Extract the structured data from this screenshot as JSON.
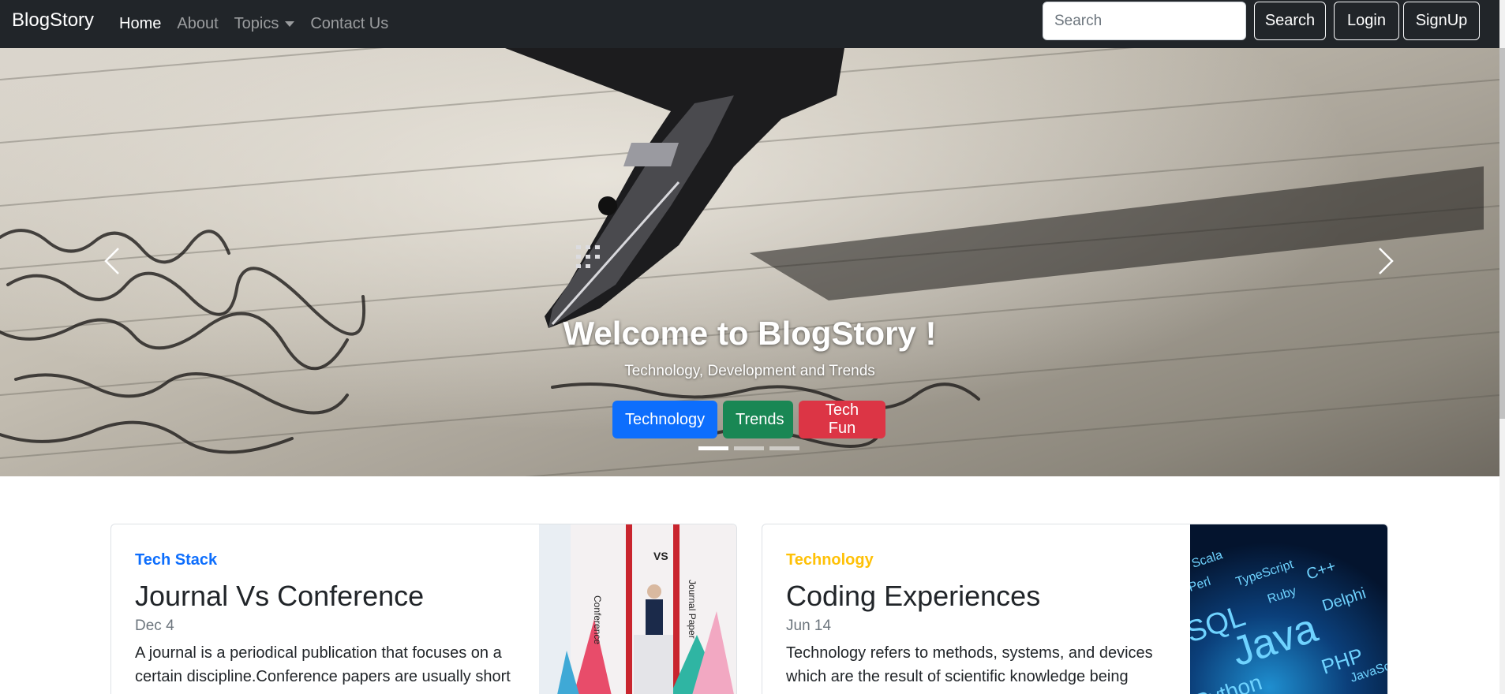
{
  "navbar": {
    "brand": "BlogStory",
    "links": [
      {
        "label": "Home",
        "active": true
      },
      {
        "label": "About"
      },
      {
        "label": "Topics",
        "dropdown": true
      },
      {
        "label": "Contact Us"
      }
    ],
    "search_placeholder": "Search",
    "search_button": "Search",
    "login_button": "Login",
    "signup_button": "SignUp"
  },
  "hero": {
    "title": "Welcome to BlogStory !",
    "subtitle": "Technology, Development and Trends",
    "buttons": [
      {
        "label": "Technology",
        "color": "#0d6efd"
      },
      {
        "label": "Trends",
        "color": "#198754"
      },
      {
        "label": "Tech Fun",
        "color": "#dc3545"
      }
    ],
    "active_slide": 1,
    "slide_count": 3
  },
  "cards": [
    {
      "category": "Tech Stack",
      "category_color": "#0d6efd",
      "title": "Journal Vs Conference",
      "date": "Dec 4",
      "text": "A journal is a periodical publication that focuses on a certain discipline.Conference papers are usually short",
      "image_labels": [
        "Conference",
        "VS",
        "Journal Paper"
      ]
    },
    {
      "category": "Technology",
      "category_color": "#ffc107",
      "title": "Coding Experiences",
      "date": "Jun 14",
      "text": "Technology refers to methods, systems, and devices which are the result of scientific knowledge being",
      "image_labels": [
        "Scala",
        "TypeScript",
        "Perl",
        "C++",
        "Ruby",
        "Delphi",
        "SQL",
        "Java",
        "PHP",
        "JavaScript",
        "Python"
      ]
    }
  ]
}
